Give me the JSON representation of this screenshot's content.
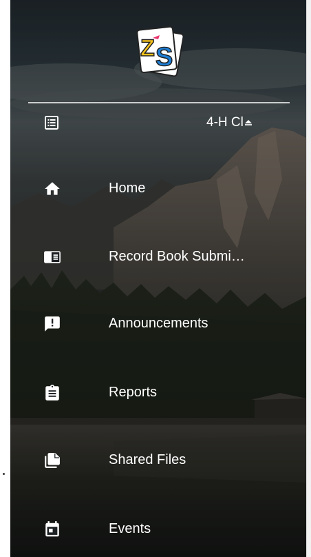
{
  "app": {
    "logo_name": "zs-logo"
  },
  "club_selector": {
    "label": "4-H Cl",
    "icon": "list-icon",
    "caret_icon": "eject-up-icon"
  },
  "nav": {
    "items": [
      {
        "label": "Home",
        "icon": "home-icon"
      },
      {
        "label": "Record Book Submi…",
        "icon": "record-book-icon"
      },
      {
        "label": "Announcements",
        "icon": "announcement-icon"
      },
      {
        "label": "Reports",
        "icon": "clipboard-icon"
      },
      {
        "label": "Shared Files",
        "icon": "files-icon"
      },
      {
        "label": "Events",
        "icon": "calendar-icon"
      }
    ]
  },
  "colors": {
    "text": "#ffffff",
    "drawer_bg": "#1d2124",
    "logo_yellow": "#f6c21b",
    "logo_blue": "#1e7fd6",
    "logo_pink": "#e8336d"
  }
}
